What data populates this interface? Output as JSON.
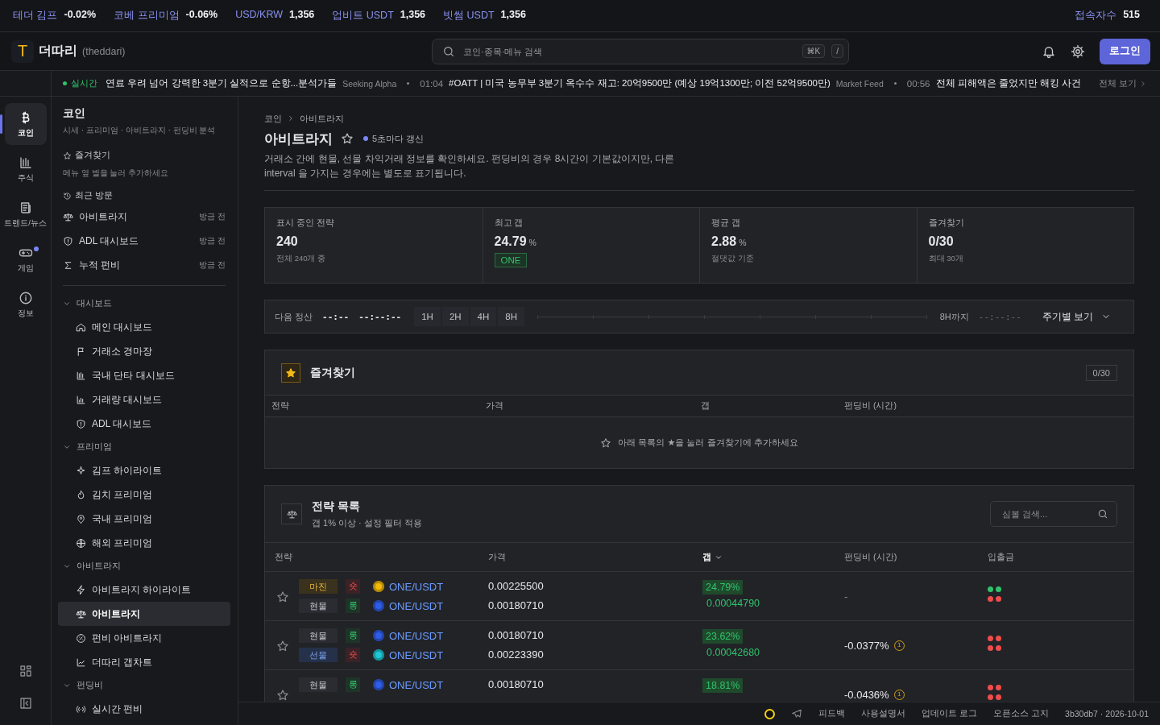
{
  "ticker_bar": {
    "items": [
      {
        "label": "테더 김프",
        "value": "-0.02%"
      },
      {
        "label": "코베 프리미엄",
        "value": "-0.06%"
      },
      {
        "label": "USD/KRW",
        "value": "1,356"
      },
      {
        "label": "업비트 USDT",
        "value": "1,356"
      },
      {
        "label": "빗썸 USDT",
        "value": "1,356"
      }
    ],
    "visitors": {
      "label": "접속자수",
      "value": "515"
    }
  },
  "header": {
    "logo_letter": "T",
    "brand": "더따리",
    "brand_sub": "(theddari)",
    "search": {
      "placeholder": "코인·종목·메뉴 검색",
      "shortcuts": [
        "⌘K",
        "/"
      ]
    },
    "login": "로그인"
  },
  "news": {
    "live": "실시간",
    "items": [
      {
        "text": "연료 우려 넘어 강력한 3분기 실적으로 순항...분석가들",
        "source": "Seeking Alpha"
      },
      {
        "time": "01:04",
        "text": "#OATT | 미국 농무부 3분기 옥수수 재고: 20억9500만 (예상 19억1300만; 이전 52억9500만)",
        "source": "Market Feed"
      },
      {
        "time": "00:56",
        "text": "전체 피해액은 줄었지만 해킹 사건"
      }
    ],
    "more": "전체 보기"
  },
  "rail": {
    "items": [
      {
        "label": "코인",
        "selected": true,
        "badge": false
      },
      {
        "label": "주식",
        "selected": false,
        "badge": false
      },
      {
        "label": "트렌드/뉴스",
        "selected": false,
        "badge": false
      },
      {
        "label": "게임",
        "selected": false,
        "badge": true
      },
      {
        "label": "정보",
        "selected": false,
        "badge": false
      }
    ]
  },
  "nav": {
    "title": "코인",
    "subtitle": "시세 · 프리미엄 · 아비트라지 · 펀딩비 분석",
    "favorites": {
      "title": "즐겨찾기",
      "hint": "메뉴 옆 별을 눌러 추가하세요"
    },
    "recent": {
      "title": "최근 방문",
      "items": [
        {
          "label": "아비트라지",
          "time": "방금 전"
        },
        {
          "label": "ADL 대시보드",
          "time": "방금 전"
        },
        {
          "label": "누적 펀비",
          "time": "방금 전"
        }
      ]
    },
    "groups": [
      {
        "title": "대시보드",
        "expanded": true,
        "items": [
          {
            "label": "메인 대시보드",
            "selected": false
          },
          {
            "label": "거래소 경마장",
            "selected": false
          },
          {
            "label": "국내 단타 대시보드",
            "selected": false
          },
          {
            "label": "거래량 대시보드",
            "selected": false
          },
          {
            "label": "ADL 대시보드",
            "selected": false
          }
        ]
      },
      {
        "title": "프리미엄",
        "expanded": true,
        "items": [
          {
            "label": "김프 하이라이트",
            "selected": false
          },
          {
            "label": "김치 프리미엄",
            "selected": false
          },
          {
            "label": "국내 프리미엄",
            "selected": false
          },
          {
            "label": "해외 프리미엄",
            "selected": false
          }
        ]
      },
      {
        "title": "아비트라지",
        "expanded": true,
        "items": [
          {
            "label": "아비트라지 하이라이트",
            "selected": false
          },
          {
            "label": "아비트라지",
            "selected": true
          },
          {
            "label": "펀비 아비트라지",
            "selected": false
          },
          {
            "label": "더따리 갭차트",
            "selected": false
          }
        ]
      },
      {
        "title": "펀딩비",
        "expanded": true,
        "items": [
          {
            "label": "실시간 펀비",
            "selected": false
          }
        ]
      }
    ]
  },
  "page": {
    "breadcrumb": [
      "코인",
      "아비트라지"
    ],
    "title": "아비트라지",
    "refresh": "5초마다 갱신",
    "description": "거래소 간에 현물, 선물 차익거래 정보를 확인하세요. 펀딩비의 경우 8시간이 기본값이지만, 다른 interval 을 가지는 경우에는 별도로 표기됩니다.",
    "stats": [
      {
        "label": "표시 중인 전략",
        "value": "240",
        "sub": "전체 240개 중"
      },
      {
        "label": "최고 갭",
        "value": "24.79",
        "unit": "%",
        "badge": "ONE"
      },
      {
        "label": "평균 갭",
        "value": "2.88",
        "unit": "%",
        "sub": "절댓값 기준"
      },
      {
        "label": "즐겨찾기",
        "value": "0/30",
        "sub": "최대 30개"
      }
    ],
    "timer": {
      "label": "다음 정산",
      "values": [
        "--:--",
        "--:--:--"
      ],
      "intervals": [
        "1H",
        "2H",
        "4H",
        "8H"
      ],
      "until_label": "8H까지",
      "until_value": "--:--:--",
      "view": "주기별 보기"
    },
    "favorites": {
      "title": "즐겨찾기",
      "count": "0/30",
      "columns": [
        "전략",
        "가격",
        "갭",
        "펀딩비 (시간)"
      ],
      "empty": "아래 목록의 ★을 눌러 즐겨찾기에 추가하세요"
    },
    "strategies": {
      "title": "전략 목록",
      "subtitle": "갭 1% 이상 · 설정 필터 적용",
      "search_placeholder": "심볼 검색...",
      "columns": [
        {
          "label": "전략",
          "sorted": false
        },
        {
          "label": "가격",
          "sorted": false
        },
        {
          "label": "갭",
          "sorted": true
        },
        {
          "label": "펀딩비 (시간)",
          "sorted": false
        },
        {
          "label": "입출금",
          "sorted": false
        }
      ],
      "rows": [
        {
          "legs": [
            {
              "market": {
                "label": "마진",
                "kind": "margin"
              },
              "side": {
                "label": "숏",
                "kind": "short"
              },
              "color": "#f0b90b",
              "pair": "ONE/USDT",
              "price": "0.00225500"
            },
            {
              "market": {
                "label": "현물",
                "kind": "spot"
              },
              "side": {
                "label": "롱",
                "kind": "long"
              },
              "color": "#2f5de8",
              "pair": "ONE/USDT",
              "price": "0.00180710"
            }
          ],
          "gap": "24.79%",
          "gap_value": "0.00044790",
          "funding": "-",
          "transfers": [
            {
              "deposit": true,
              "withdraw": true
            },
            {
              "deposit": false,
              "withdraw": false
            }
          ]
        },
        {
          "legs": [
            {
              "market": {
                "label": "현물",
                "kind": "spot"
              },
              "side": {
                "label": "롱",
                "kind": "long"
              },
              "color": "#2f5de8",
              "pair": "ONE/USDT",
              "price": "0.00180710"
            },
            {
              "market": {
                "label": "선물",
                "kind": "futures"
              },
              "side": {
                "label": "숏",
                "kind": "short"
              },
              "color": "#1fc7d4",
              "pair": "ONE/USDT",
              "price": "0.00223390"
            }
          ],
          "gap": "23.62%",
          "gap_value": "0.00042680",
          "funding": "-0.0377%",
          "funding_badge": "1",
          "transfers": [
            {
              "deposit": false,
              "withdraw": false
            },
            {
              "deposit": false,
              "withdraw": false
            }
          ]
        },
        {
          "legs": [
            {
              "market": {
                "label": "현물",
                "kind": "spot"
              },
              "side": {
                "label": "롱",
                "kind": "long"
              },
              "color": "#2f5de8",
              "pair": "ONE/USDT",
              "price": "0.00180710"
            }
          ],
          "gap": "18.81%",
          "funding": "-0.0436%",
          "funding_badge": "1",
          "transfers": [
            {
              "deposit": false,
              "withdraw": false
            },
            {
              "deposit": false,
              "withdraw": false
            }
          ]
        }
      ]
    }
  },
  "footer": {
    "links": [
      "피드백",
      "사용설명서",
      "업데이트 로그",
      "오픈소스 고지"
    ],
    "version": "3b30db7 · 2026-10-01"
  }
}
